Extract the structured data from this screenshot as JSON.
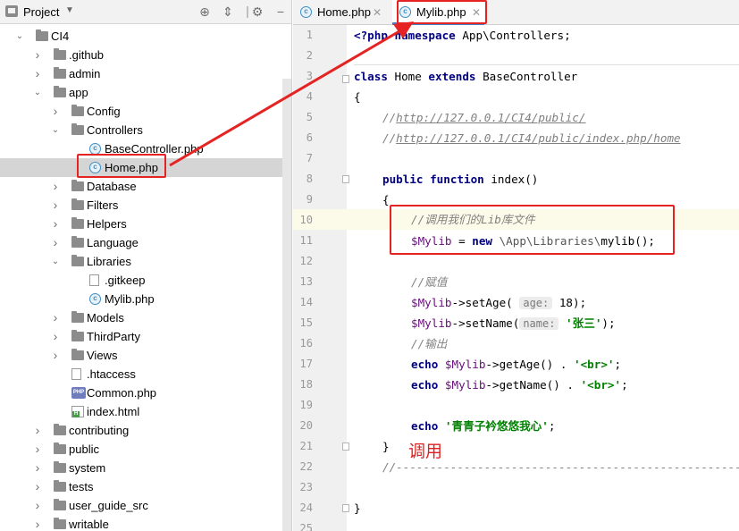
{
  "project_panel": {
    "title": "Project",
    "tree": [
      {
        "label": "CI4",
        "type": "folder",
        "expanded": true
      },
      {
        "label": ".github",
        "type": "folder",
        "expanded": false
      },
      {
        "label": "admin",
        "type": "folder",
        "expanded": false
      },
      {
        "label": "app",
        "type": "folder",
        "expanded": true
      },
      {
        "label": "Config",
        "type": "folder",
        "expanded": false
      },
      {
        "label": "Controllers",
        "type": "folder",
        "expanded": true
      },
      {
        "label": "BaseController.php",
        "type": "class-file"
      },
      {
        "label": "Home.php",
        "type": "class-file",
        "selected": true
      },
      {
        "label": "Database",
        "type": "folder",
        "expanded": false
      },
      {
        "label": "Filters",
        "type": "folder",
        "expanded": false
      },
      {
        "label": "Helpers",
        "type": "folder",
        "expanded": false
      },
      {
        "label": "Language",
        "type": "folder",
        "expanded": false
      },
      {
        "label": "Libraries",
        "type": "folder",
        "expanded": true
      },
      {
        "label": ".gitkeep",
        "type": "git-file"
      },
      {
        "label": "Mylib.php",
        "type": "class-file"
      },
      {
        "label": "Models",
        "type": "folder",
        "expanded": false
      },
      {
        "label": "ThirdParty",
        "type": "folder",
        "expanded": false
      },
      {
        "label": "Views",
        "type": "folder",
        "expanded": false
      },
      {
        "label": ".htaccess",
        "type": "htaccess-file"
      },
      {
        "label": "Common.php",
        "type": "php-file"
      },
      {
        "label": "index.html",
        "type": "html-file"
      },
      {
        "label": "contributing",
        "type": "folder",
        "expanded": false
      },
      {
        "label": "public",
        "type": "folder",
        "expanded": false
      },
      {
        "label": "system",
        "type": "folder",
        "expanded": false
      },
      {
        "label": "tests",
        "type": "folder",
        "expanded": false
      },
      {
        "label": "user_guide_src",
        "type": "folder",
        "expanded": false
      },
      {
        "label": "writable",
        "type": "folder",
        "expanded": false
      }
    ],
    "header_icons": [
      "target-icon",
      "collapse-icon",
      "gear-icon",
      "minimize-icon"
    ]
  },
  "editor": {
    "tabs": [
      {
        "label": "Home.php",
        "active": false
      },
      {
        "label": "Mylib.php",
        "active": true
      }
    ],
    "line_numbers": [
      "1",
      "2",
      "3",
      "4",
      "5",
      "6",
      "7",
      "8",
      "9",
      "10",
      "11",
      "12",
      "13",
      "14",
      "15",
      "16",
      "17",
      "18",
      "19",
      "20",
      "21",
      "22",
      "23",
      "24",
      "25"
    ],
    "code": {
      "l1_tag": "<?php",
      "l1_kw": "namespace",
      "l1_rest": " App\\Controllers;",
      "l3_kw1": "class",
      "l3_mid": " Home ",
      "l3_kw2": "extends",
      "l3_rest": " BaseController",
      "l4": "{",
      "l5_slash": "//",
      "l5_url": "http://127.0.0.1/CI4/public/",
      "l6_slash": "//",
      "l6_url": "http://127.0.0.1/CI4/public/index.php/home",
      "l8_kw": "public function",
      "l8_rest": " index()",
      "l9": "{",
      "l10": "//调用我们的Lib库文件",
      "l11_var": "$Mylib",
      "l11_eq": " = ",
      "l11_kw": "new",
      "l11_ns": " \\App\\Libraries\\",
      "l11_rest": "mylib();",
      "l13": "//赋值",
      "l14_var": "$Mylib",
      "l14_call": "->setAge(",
      "l14_hint": "age:",
      "l14_rest": " 18);",
      "l15_var": "$Mylib",
      "l15_call": "->setName(",
      "l15_hint": "name:",
      "l15_str": "'张三'",
      "l15_rest": ");",
      "l16": "//输出",
      "l17_kw": "echo",
      "l17_var": " $Mylib",
      "l17_call": "->getAge() . ",
      "l17_str": "'<br>'",
      "l17_rest": ";",
      "l18_kw": "echo",
      "l18_var": " $Mylib",
      "l18_call": "->getName() . ",
      "l18_str": "'<br>'",
      "l18_rest": ";",
      "l20_kw": "echo",
      "l20_str": " '青青子衿悠悠我心'",
      "l20_rest": ";",
      "l21": "}",
      "l22": "//-------------------------------------------------------",
      "l24": "}"
    }
  },
  "annotation": {
    "text": "调用",
    "color": "#e62323"
  }
}
